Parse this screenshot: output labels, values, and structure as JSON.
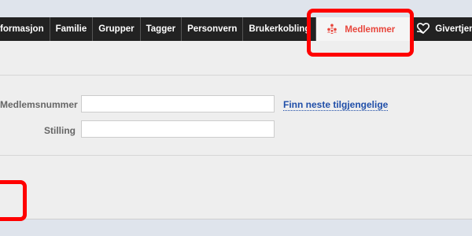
{
  "tabs": [
    {
      "label": "formasjon"
    },
    {
      "label": "Familie"
    },
    {
      "label": "Grupper"
    },
    {
      "label": "Tagger"
    },
    {
      "label": "Personvern"
    },
    {
      "label": "Brukerkobling"
    },
    {
      "label": "Medlemmer",
      "icon": "people-pyramid-icon",
      "active": true
    },
    {
      "label": "Givertjen",
      "icon": "heart-hand-icon"
    }
  ],
  "form": {
    "member_number_label": "Medlemsnummer",
    "member_number_value": "",
    "position_label": "Stilling",
    "position_value": "",
    "find_next_link": "Finn neste tilgjengelige"
  },
  "colors": {
    "active_tab": "#e8463c",
    "tab_bar": "#222222",
    "link": "#1f4ea8",
    "highlight": "#ff0000"
  }
}
